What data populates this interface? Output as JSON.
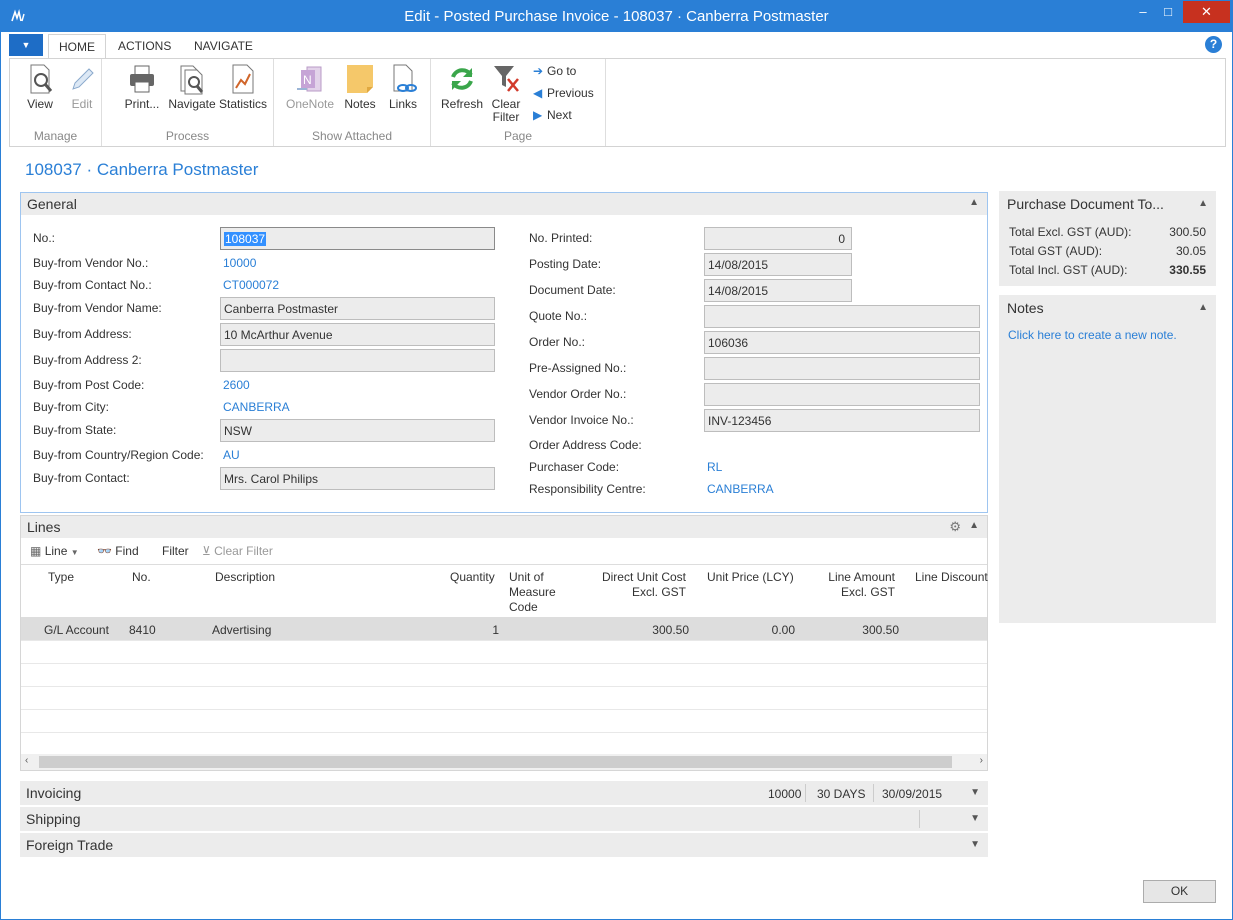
{
  "window": {
    "title": "Edit - Posted Purchase Invoice - 108037 · Canberra Postmaster",
    "minimize": "–",
    "maximize": "□",
    "close": "✕"
  },
  "ribbon_tabs": {
    "home": "HOME",
    "actions": "ACTIONS",
    "navigate": "NAVIGATE",
    "help": "?"
  },
  "ribbon": {
    "manage": {
      "label": "Manage",
      "view": "View",
      "edit": "Edit"
    },
    "process": {
      "label": "Process",
      "print": "Print...",
      "navigate": "Navigate",
      "statistics": "Statistics"
    },
    "show_attached": {
      "label": "Show Attached",
      "onenote": "OneNote",
      "notes": "Notes",
      "links": "Links"
    },
    "page": {
      "label": "Page",
      "refresh": "Refresh",
      "clear_filter_1": "Clear",
      "clear_filter_2": "Filter",
      "go_to": "Go to",
      "previous": "Previous",
      "next": "Next"
    }
  },
  "page_title": "108037 · Canberra Postmaster",
  "general": {
    "header": "General",
    "no": {
      "label": "No.:",
      "value": "108037"
    },
    "vendor_no": {
      "label": "Buy-from Vendor No.:",
      "value": "10000"
    },
    "contact_no": {
      "label": "Buy-from Contact No.:",
      "value": "CT000072"
    },
    "vendor_name": {
      "label": "Buy-from Vendor Name:",
      "value": "Canberra Postmaster"
    },
    "address": {
      "label": "Buy-from Address:",
      "value": "10 McArthur Avenue"
    },
    "address2": {
      "label": "Buy-from Address 2:",
      "value": ""
    },
    "post_code": {
      "label": "Buy-from Post Code:",
      "value": "2600"
    },
    "city": {
      "label": "Buy-from City:",
      "value": "CANBERRA"
    },
    "state": {
      "label": "Buy-from State:",
      "value": "NSW"
    },
    "country": {
      "label": "Buy-from Country/Region Code:",
      "value": "AU"
    },
    "contact": {
      "label": "Buy-from Contact:",
      "value": "Mrs. Carol Philips"
    },
    "no_printed": {
      "label": "No. Printed:",
      "value": "0"
    },
    "posting_date": {
      "label": "Posting Date:",
      "value": "14/08/2015"
    },
    "document_date": {
      "label": "Document Date:",
      "value": "14/08/2015"
    },
    "quote_no": {
      "label": "Quote No.:",
      "value": ""
    },
    "order_no": {
      "label": "Order No.:",
      "value": "106036"
    },
    "preassigned_no": {
      "label": "Pre-Assigned No.:",
      "value": ""
    },
    "vendor_order_no": {
      "label": "Vendor Order No.:",
      "value": ""
    },
    "vendor_invoice_no": {
      "label": "Vendor Invoice No.:",
      "value": "INV-123456"
    },
    "order_address_code": {
      "label": "Order Address Code:",
      "value": ""
    },
    "purchaser_code": {
      "label": "Purchaser Code:",
      "value": "RL"
    },
    "responsibility_centre": {
      "label": "Responsibility Centre:",
      "value": "CANBERRA"
    }
  },
  "lines": {
    "header": "Lines",
    "toolbar": {
      "line": "Line",
      "find": "Find",
      "filter": "Filter",
      "clear_filter": "Clear Filter"
    },
    "columns": {
      "type": "Type",
      "no": "No.",
      "description": "Description",
      "quantity": "Quantity",
      "uom_1": "Unit of",
      "uom_2": "Measure",
      "uom_3": "Code",
      "direct_cost_1": "Direct Unit Cost",
      "direct_cost_2": "Excl. GST",
      "unit_price": "Unit Price (LCY)",
      "line_amount_1": "Line Amount",
      "line_amount_2": "Excl. GST",
      "line_discount": "Line Discount"
    },
    "rows": [
      {
        "type": "G/L Account",
        "no": "8410",
        "description": "Advertising",
        "quantity": "1",
        "uom": "",
        "direct_cost": "300.50",
        "unit_price": "0.00",
        "line_amount": "300.50",
        "line_discount": ""
      }
    ]
  },
  "fasttabs": {
    "invoicing": {
      "label": "Invoicing",
      "v1": "10000",
      "v2": "30 DAYS",
      "v3": "30/09/2015"
    },
    "shipping": {
      "label": "Shipping"
    },
    "foreign_trade": {
      "label": "Foreign Trade"
    }
  },
  "totals": {
    "header": "Purchase Document To...",
    "excl": {
      "label": "Total Excl. GST (AUD):",
      "value": "300.50"
    },
    "gst": {
      "label": "Total GST (AUD):",
      "value": "30.05"
    },
    "incl": {
      "label": "Total Incl. GST (AUD):",
      "value": "330.55"
    }
  },
  "notes": {
    "header": "Notes",
    "link": "Click here to create a new note."
  },
  "ok_button": "OK",
  "colors": {
    "accent": "#2a7fd6",
    "close": "#c7311f",
    "panel_header": "#ececec"
  }
}
